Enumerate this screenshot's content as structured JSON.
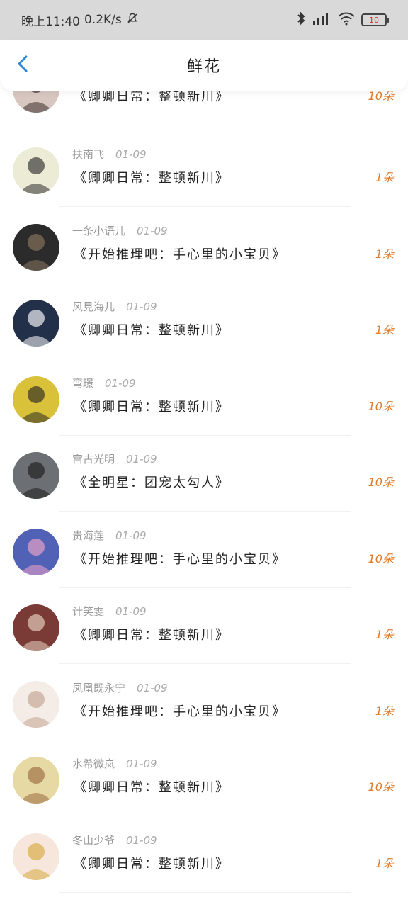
{
  "status_bar": {
    "time": "晚上11:40",
    "speed": "0.2K/s",
    "battery": "10"
  },
  "nav": {
    "title": "鲜花"
  },
  "colors": {
    "accent": "#2f86d6",
    "amount": "#e07b2a"
  },
  "items": [
    {
      "name": "",
      "date": "",
      "book": "《卿卿日常：整顿新川》",
      "amount": "10朵",
      "avatar": {
        "bg": "#d8c7c1",
        "fg": "#3a2b2a"
      }
    },
    {
      "name": "扶南飞",
      "date": "01-09",
      "book": "《卿卿日常：整顿新川》",
      "amount": "1朵",
      "avatar": {
        "bg": "#ecebd5",
        "fg": "#2e2e2e"
      }
    },
    {
      "name": "一条小语儿",
      "date": "01-09",
      "book": "《开始推理吧：手心里的小宝贝》",
      "amount": "1朵",
      "avatar": {
        "bg": "#2b2b2b",
        "fg": "#8a7760"
      }
    },
    {
      "name": "风見海儿",
      "date": "01-09",
      "book": "《卿卿日常：整顿新川》",
      "amount": "1朵",
      "avatar": {
        "bg": "#22304a",
        "fg": "#ffffff"
      }
    },
    {
      "name": "弯璟",
      "date": "01-09",
      "book": "《卿卿日常：整顿新川》",
      "amount": "10朵",
      "avatar": {
        "bg": "#d9c13a",
        "fg": "#2a2a20"
      }
    },
    {
      "name": "宫古光明",
      "date": "01-09",
      "book": "《全明星：团宠太勾人》",
      "amount": "10朵",
      "avatar": {
        "bg": "#6c6f74",
        "fg": "#1b1b1b"
      }
    },
    {
      "name": "贵海莲",
      "date": "01-09",
      "book": "《开始推理吧：手心里的小宝贝》",
      "amount": "10朵",
      "avatar": {
        "bg": "#5161b6",
        "fg": "#f2a5c8"
      }
    },
    {
      "name": "计笑雯",
      "date": "01-09",
      "book": "《卿卿日常：整顿新川》",
      "amount": "1朵",
      "avatar": {
        "bg": "#7a3a35",
        "fg": "#e9d5c5"
      }
    },
    {
      "name": "凤凰既永宁",
      "date": "01-09",
      "book": "《开始推理吧：手心里的小宝贝》",
      "amount": "1朵",
      "avatar": {
        "bg": "#f3ece7",
        "fg": "#c3a48f"
      }
    },
    {
      "name": "水希微岚",
      "date": "01-09",
      "book": "《卿卿日常：整顿新川》",
      "amount": "10朵",
      "avatar": {
        "bg": "#e7d9a4",
        "fg": "#9b6a3d"
      }
    },
    {
      "name": "冬山少爷",
      "date": "01-09",
      "book": "《卿卿日常：整顿新川》",
      "amount": "1朵",
      "avatar": {
        "bg": "#f6e6dc",
        "fg": "#d7a93f"
      }
    }
  ]
}
